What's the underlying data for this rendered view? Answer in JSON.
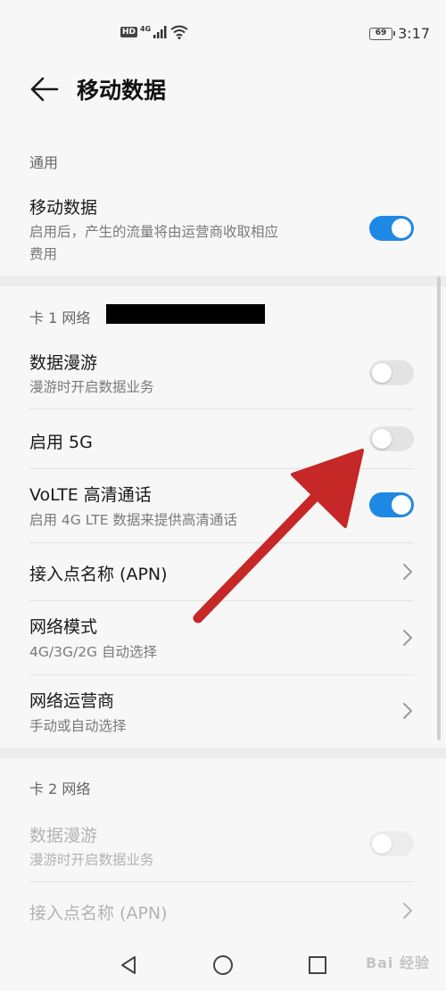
{
  "status_bar": {
    "hd_badge": "HD",
    "network_badge": "4G",
    "battery_level": "69",
    "time": "3:17",
    "icons": [
      "hd-icon",
      "signal-icon",
      "wifi-icon",
      "battery-icon"
    ]
  },
  "header": {
    "title": "移动数据",
    "back_icon": "arrow-left-icon"
  },
  "general": {
    "section_title": "通用",
    "mobile_data": {
      "title": "移动数据",
      "subtitle_line1": "启用后，产生的流量将由运营商收取相应",
      "subtitle_line2": "费用",
      "enabled": true
    }
  },
  "sim1": {
    "section_title": "卡 1 网络",
    "data_roaming": {
      "title": "数据漫游",
      "subtitle": "漫游时开启数据业务",
      "enabled": false
    },
    "enable_5g": {
      "title": "启用 5G",
      "enabled": false
    },
    "volte": {
      "title": "VoLTE 高清通话",
      "subtitle": "启用 4G LTE 数据来提供高清通话",
      "enabled": true
    },
    "apn": {
      "title": "接入点名称 (APN)"
    },
    "network_mode": {
      "title": "网络模式",
      "subtitle": "4G/3G/2G 自动选择"
    },
    "carrier": {
      "title": "网络运营商",
      "subtitle": "手动或自动选择"
    }
  },
  "sim2": {
    "section_title": "卡 2 网络",
    "data_roaming": {
      "title": "数据漫游",
      "subtitle": "漫游时开启数据业务",
      "enabled": false
    },
    "apn": {
      "title": "接入点名称 (APN)"
    }
  },
  "nav_bar": {
    "icons": [
      "back-triangle-icon",
      "home-circle-icon",
      "recents-square-icon"
    ]
  },
  "watermark": "Bai 经验",
  "colors": {
    "accent": "#1e88e5",
    "annotation_arrow": "#c62828",
    "background": "#f7f7f7"
  }
}
